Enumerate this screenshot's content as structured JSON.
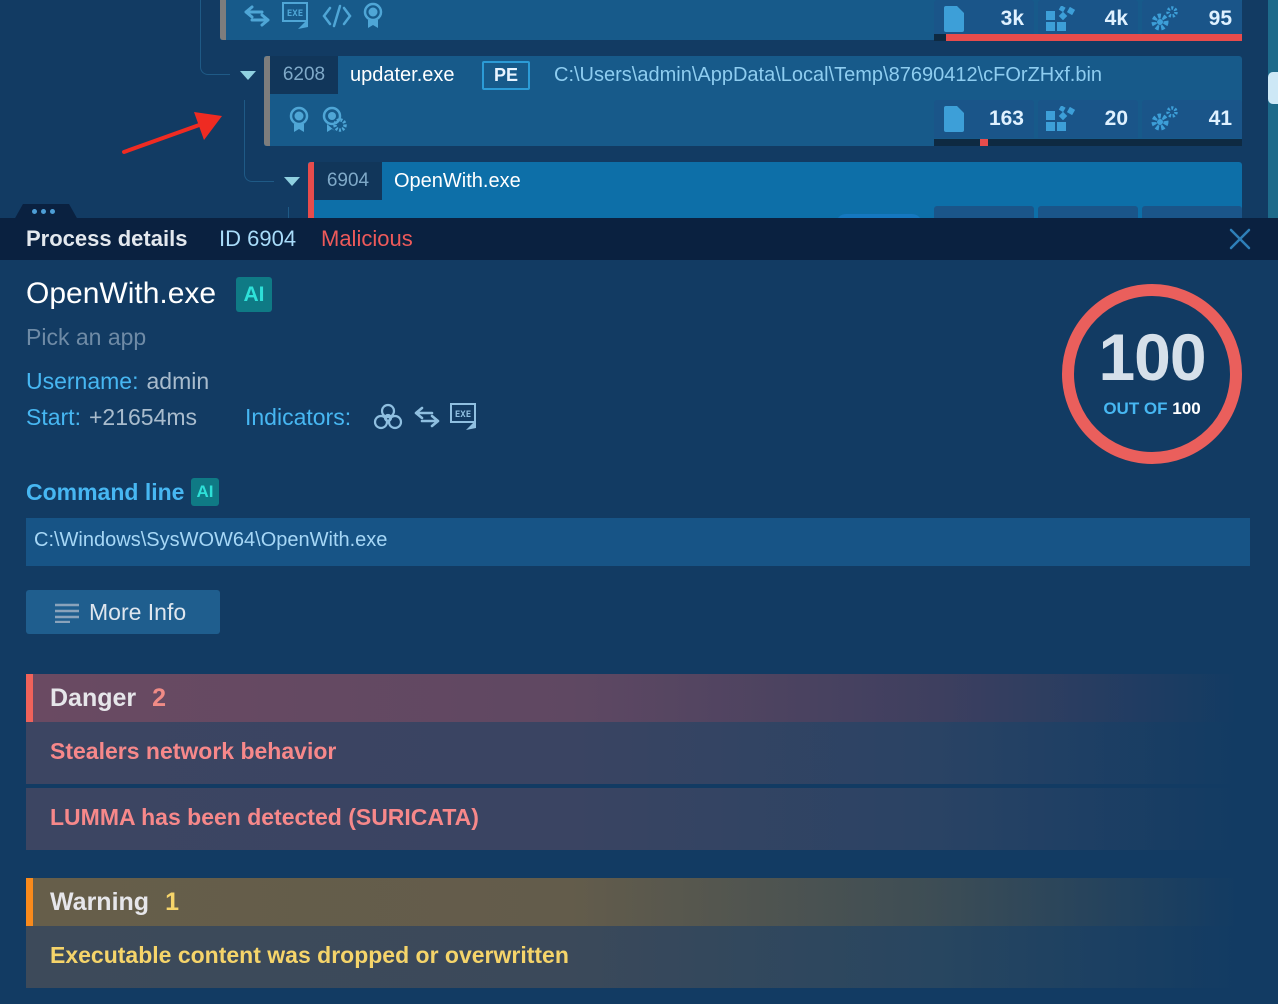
{
  "process_tree": {
    "prev_process": {
      "stats": {
        "files": "3k",
        "modules": "4k",
        "threads": "95"
      },
      "bar_fill_fraction": 0.96,
      "indicators": [
        "network-exchange-icon",
        "exe-drop-icon",
        "code-icon",
        "award-icon"
      ]
    },
    "updater": {
      "pid": "6208",
      "name": "updater.exe",
      "type_badge": "PE",
      "path": "C:\\Users\\admin\\AppData\\Local\\Temp\\87690412\\cFOrZHxf.bin",
      "indicators": [
        "award-icon",
        "award-gear-icon"
      ],
      "stats": {
        "files": "163",
        "modules": "20",
        "threads": "41"
      },
      "bar_marker_fraction": 0.15
    },
    "openwith": {
      "pid": "6904",
      "name": "OpenWith.exe"
    }
  },
  "details": {
    "header": {
      "title": "Process details",
      "id_label": "ID 6904",
      "status": "Malicious"
    },
    "process_name": "OpenWith.exe",
    "ai_badge": "AI",
    "description": "Pick an app",
    "username_label": "Username:",
    "username": "admin",
    "start_label": "Start:",
    "start": "+21654ms",
    "indicators_label": "Indicators:",
    "indicators": [
      "biohazard-icon",
      "network-exchange-icon",
      "exe-drop-icon"
    ],
    "score": {
      "value": "100",
      "out_of_label": "OUT OF",
      "max": "100"
    },
    "command_line_label": "Command line",
    "command_line": "C:\\Windows\\SysWOW64\\OpenWith.exe",
    "more_info_label": "More Info",
    "danger": {
      "title": "Danger",
      "count": "2",
      "items": [
        "Stealers network behavior",
        "LUMMA has been detected (SURICATA)"
      ]
    },
    "warning": {
      "title": "Warning",
      "count": "1",
      "items": [
        "Executable content was dropped or overwritten"
      ]
    }
  },
  "colors": {
    "background": "#123b63",
    "malicious": "#ee5a5a",
    "accent": "#47b7f2",
    "danger": "#f0625a",
    "warning": "#f98a1c"
  }
}
